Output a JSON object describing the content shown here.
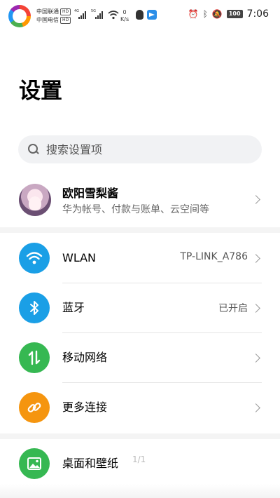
{
  "status_bar": {
    "carrier_1": "中国联通",
    "carrier_2": "中国电信",
    "hd_badge": "HD",
    "net_tag_1": "4G",
    "net_tag_2": "5G",
    "speed_value": "0",
    "speed_unit": "K/s",
    "battery": "100",
    "time": "7:06",
    "icons": [
      "app-ring-icon",
      "signal-icon",
      "wifi-icon",
      "qq-icon",
      "telegram-icon",
      "alarm-icon",
      "bluetooth-icon",
      "mute-icon",
      "battery-icon"
    ]
  },
  "title": "设置",
  "search": {
    "placeholder": "搜索设置项"
  },
  "profile": {
    "name": "欧阳雪梨酱",
    "subtitle": "华为帐号、付款与账单、云空间等"
  },
  "rows": [
    {
      "label": "WLAN",
      "value": "TP-LINK_A786",
      "icon": "wifi-icon",
      "color": "#1a9fe6"
    },
    {
      "label": "蓝牙",
      "value": "已开启",
      "icon": "bluetooth-icon",
      "color": "#1a9fe6"
    },
    {
      "label": "移动网络",
      "value": "",
      "icon": "mobile-data-icon",
      "color": "#36b852"
    },
    {
      "label": "更多连接",
      "value": "",
      "icon": "link-icon",
      "color": "#f5950f"
    },
    {
      "label": "桌面和壁纸",
      "value": "",
      "icon": "wallpaper-icon",
      "color": "#36b852"
    }
  ],
  "page_indicator": "1/1"
}
